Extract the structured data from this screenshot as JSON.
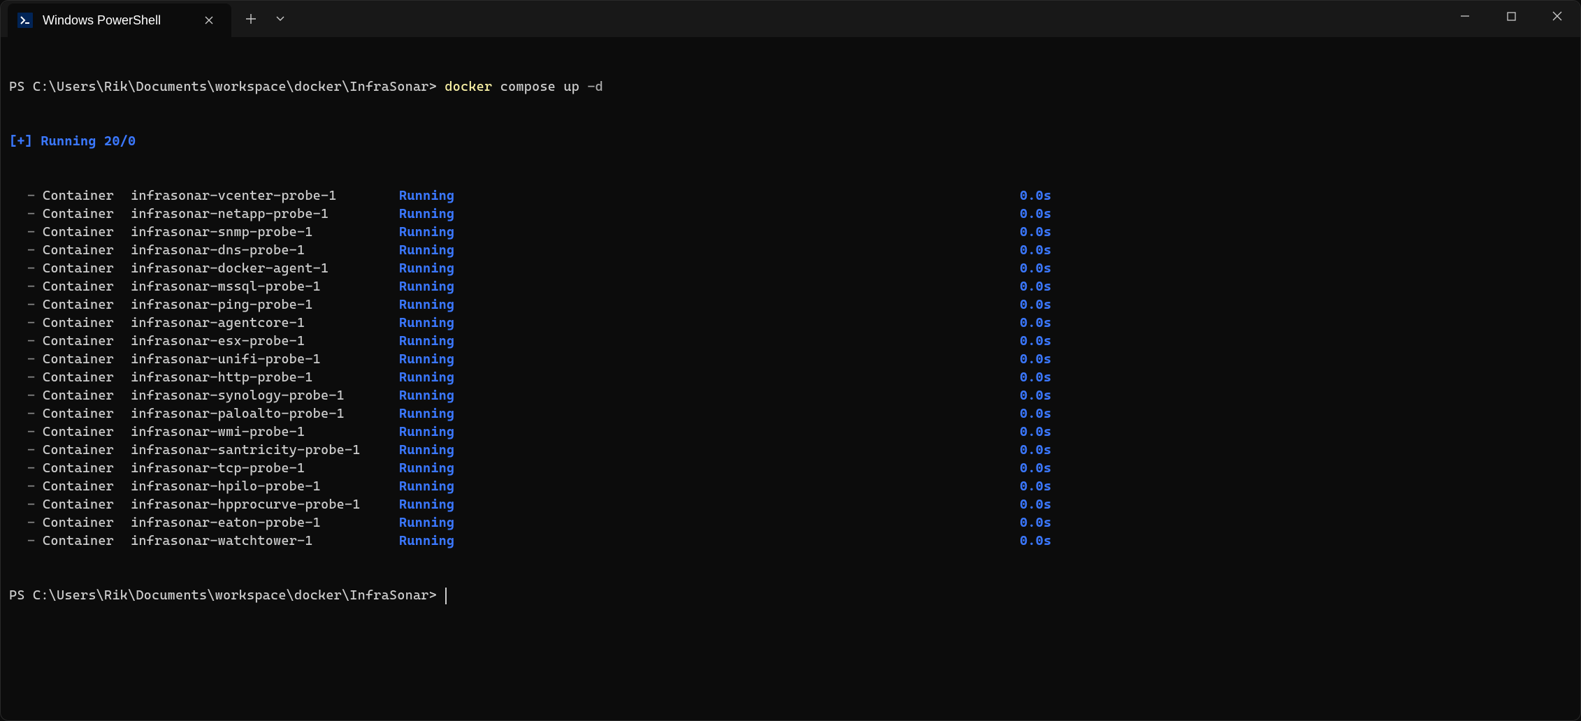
{
  "window": {
    "tab_title": "Windows PowerShell"
  },
  "terminal": {
    "prompt1_prefix": "PS ",
    "prompt1_path": "C:\\Users\\Rik\\Documents\\workspace\\docker\\InfraSonar>",
    "command_exec": "docker",
    "command_args": "compose up",
    "command_flag": "-d",
    "summary_prefix": "[+]",
    "summary_text": "Running 20/0",
    "dash": "-",
    "container_label": "Container",
    "containers": [
      {
        "name": "infrasonar-vcenter-probe-1",
        "status": "Running",
        "time": "0.0s"
      },
      {
        "name": "infrasonar-netapp-probe-1",
        "status": "Running",
        "time": "0.0s"
      },
      {
        "name": "infrasonar-snmp-probe-1",
        "status": "Running",
        "time": "0.0s"
      },
      {
        "name": "infrasonar-dns-probe-1",
        "status": "Running",
        "time": "0.0s"
      },
      {
        "name": "infrasonar-docker-agent-1",
        "status": "Running",
        "time": "0.0s"
      },
      {
        "name": "infrasonar-mssql-probe-1",
        "status": "Running",
        "time": "0.0s"
      },
      {
        "name": "infrasonar-ping-probe-1",
        "status": "Running",
        "time": "0.0s"
      },
      {
        "name": "infrasonar-agentcore-1",
        "status": "Running",
        "time": "0.0s"
      },
      {
        "name": "infrasonar-esx-probe-1",
        "status": "Running",
        "time": "0.0s"
      },
      {
        "name": "infrasonar-unifi-probe-1",
        "status": "Running",
        "time": "0.0s"
      },
      {
        "name": "infrasonar-http-probe-1",
        "status": "Running",
        "time": "0.0s"
      },
      {
        "name": "infrasonar-synology-probe-1",
        "status": "Running",
        "time": "0.0s"
      },
      {
        "name": "infrasonar-paloalto-probe-1",
        "status": "Running",
        "time": "0.0s"
      },
      {
        "name": "infrasonar-wmi-probe-1",
        "status": "Running",
        "time": "0.0s"
      },
      {
        "name": "infrasonar-santricity-probe-1",
        "status": "Running",
        "time": "0.0s"
      },
      {
        "name": "infrasonar-tcp-probe-1",
        "status": "Running",
        "time": "0.0s"
      },
      {
        "name": "infrasonar-hpilo-probe-1",
        "status": "Running",
        "time": "0.0s"
      },
      {
        "name": "infrasonar-hpprocurve-probe-1",
        "status": "Running",
        "time": "0.0s"
      },
      {
        "name": "infrasonar-eaton-probe-1",
        "status": "Running",
        "time": "0.0s"
      },
      {
        "name": "infrasonar-watchtower-1",
        "status": "Running",
        "time": "0.0s"
      }
    ],
    "prompt2_prefix": "PS ",
    "prompt2_path": "C:\\Users\\Rik\\Documents\\workspace\\docker\\InfraSonar>"
  }
}
